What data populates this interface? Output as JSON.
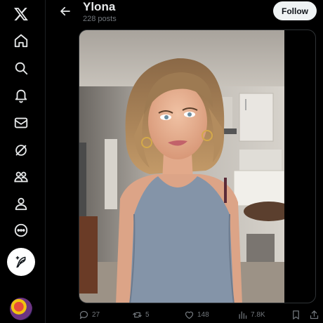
{
  "sidebar": {
    "items": [
      {
        "name": "x-logo-icon"
      },
      {
        "name": "home-icon"
      },
      {
        "name": "search-icon"
      },
      {
        "name": "notifications-icon"
      },
      {
        "name": "messages-icon"
      },
      {
        "name": "grok-icon"
      },
      {
        "name": "communities-icon"
      },
      {
        "name": "profile-icon"
      },
      {
        "name": "more-icon"
      }
    ],
    "compose_icon": "compose-post-icon"
  },
  "header": {
    "title": "Ylona",
    "subtitle": "228 posts",
    "follow_label": "Follow"
  },
  "post": {
    "replies": "27",
    "reposts": "5",
    "likes": "148",
    "views": "7.8K"
  },
  "colors": {
    "background": "#000000",
    "text": "#e7e9ea",
    "muted": "#71767b",
    "follow_bg": "#eff3f4"
  }
}
